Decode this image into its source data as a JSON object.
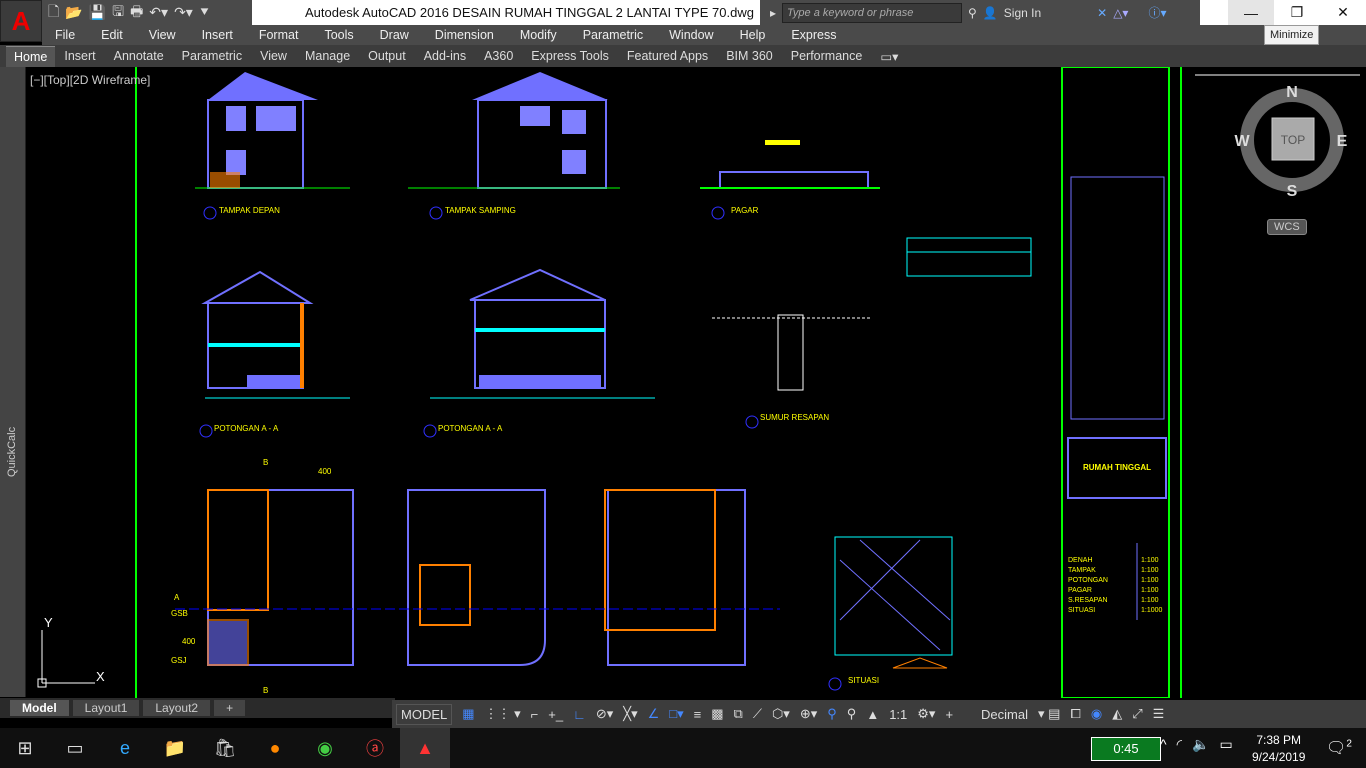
{
  "app": {
    "title": "Autodesk AutoCAD 2016    DESAIN RUMAH TINGGAL 2 LANTAI TYPE 70.dwg",
    "search_placeholder": "Type a keyword or phrase",
    "sign_in": "Sign In",
    "tooltip": "Minimize"
  },
  "menu": [
    "File",
    "Edit",
    "View",
    "Insert",
    "Format",
    "Tools",
    "Draw",
    "Dimension",
    "Modify",
    "Parametric",
    "Window",
    "Help",
    "Express"
  ],
  "ribbon": [
    "Home",
    "Insert",
    "Annotate",
    "Parametric",
    "View",
    "Manage",
    "Output",
    "Add-ins",
    "A360",
    "Express Tools",
    "Featured Apps",
    "BIM 360",
    "Performance"
  ],
  "side": {
    "quickcalc": "QuickCalc",
    "viewport_label": "[−][Top][2D Wireframe]"
  },
  "viewcube": {
    "n": "N",
    "s": "S",
    "e": "E",
    "w": "W",
    "top": "TOP",
    "wcs": "WCS"
  },
  "drawing": {
    "labels": [
      "TAMPAK DEPAN",
      "TAMPAK SAMPING",
      "PAGAR",
      "POTONGAN A - A",
      "POTONGAN A - A",
      "SUMUR RESAPAN",
      "SITUASI"
    ],
    "dims": {
      "d400a": "400",
      "d400b": "400",
      "gsb": "GSB",
      "gsj": "GSJ",
      "A": "A",
      "B": "B"
    },
    "title_block": {
      "title": "RUMAH TINGGAL",
      "scales": [
        [
          "DENAH",
          "1:100"
        ],
        [
          "TAMPAK",
          "1:100"
        ],
        [
          "POTONGAN",
          "1:100"
        ],
        [
          "PAGAR",
          "1:100"
        ],
        [
          "S.RESAPAN",
          "1:100"
        ],
        [
          "SITUASI",
          "1:1000"
        ]
      ]
    },
    "colors": {
      "wall": "#7070ff",
      "orange": "#ff8000",
      "text": "#ffff00",
      "frame": "#00ff00",
      "cyan": "#00ffff"
    }
  },
  "tabs": [
    "Model",
    "Layout1",
    "Layout2"
  ],
  "status": {
    "model": "MODEL",
    "scale": "1:1",
    "units": "Decimal"
  },
  "taskbar": {
    "battery": "0:45",
    "time": "7:38 PM",
    "date": "9/24/2019",
    "notifications": "2"
  }
}
